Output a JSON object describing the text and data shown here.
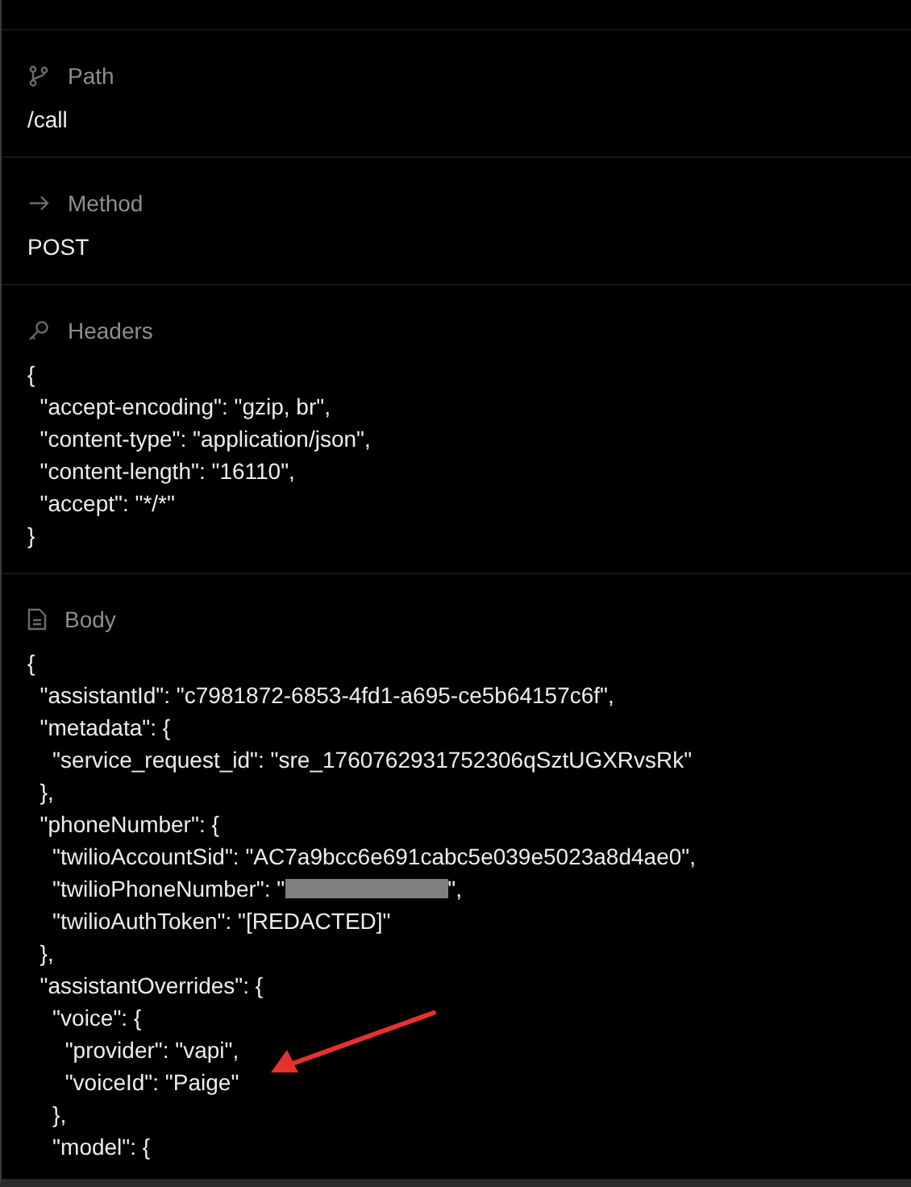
{
  "sections": [
    {
      "label": "Path",
      "lines": [
        {
          "text": "/call"
        }
      ]
    },
    {
      "label": "Method",
      "lines": [
        {
          "text": "POST"
        }
      ]
    },
    {
      "label": "Headers",
      "lines": [
        {
          "text": "{"
        },
        {
          "text": "  \"accept-encoding\": \"gzip, br\","
        },
        {
          "text": "  \"content-type\": \"application/json\","
        },
        {
          "text": "  \"content-length\": \"16110\","
        },
        {
          "text": "  \"accept\": \"*/*\""
        },
        {
          "text": "}"
        }
      ]
    },
    {
      "label": "Body",
      "lines": [
        {
          "text": "{"
        },
        {
          "text": "  \"assistantId\": \"c7981872-6853-4fd1-a695-ce5b64157c6f\","
        },
        {
          "text": "  \"metadata\": {"
        },
        {
          "text": "    \"service_request_id\": \"sre_1760762931752306qSztUGXRvsRk\""
        },
        {
          "text": "  },"
        },
        {
          "text": "  \"phoneNumber\": {"
        },
        {
          "text": "    \"twilioAccountSid\": \"AC7a9bcc6e691cabc5e039e5023a8d4ae0\","
        },
        {
          "text": "    \"twilioPhoneNumber\": \"",
          "redacted": true,
          "suffix": "\","
        },
        {
          "text": "    \"twilioAuthToken\": \"[REDACTED]\""
        },
        {
          "text": "  },"
        },
        {
          "text": "  \"assistantOverrides\": {"
        },
        {
          "text": "    \"voice\": {"
        },
        {
          "text": "      \"provider\": \"vapi\","
        },
        {
          "text": "      \"voiceId\": \"Paige\""
        },
        {
          "text": "    },"
        },
        {
          "text": "    \"model\": {"
        }
      ]
    }
  ],
  "annotations": [
    {
      "kind": "arrow"
    }
  ]
}
